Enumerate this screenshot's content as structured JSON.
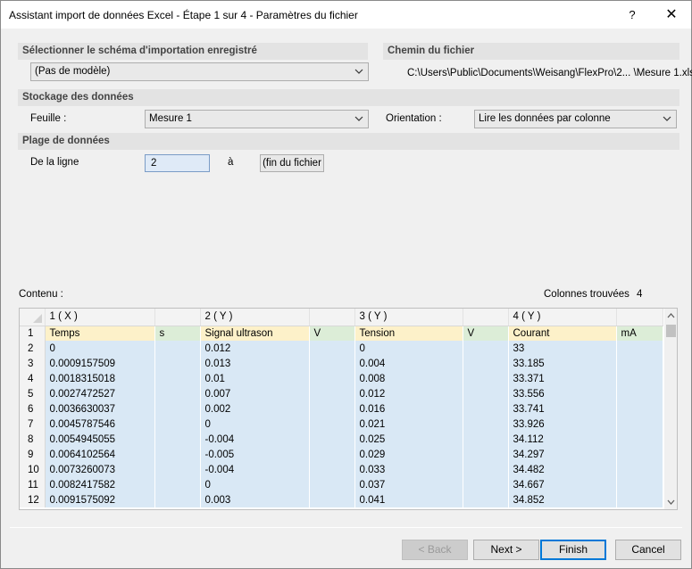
{
  "window": {
    "title": "Assistant import de données Excel - Étape 1 sur 4 - Paramètres du fichier",
    "help_glyph": "?",
    "close_glyph": "✕"
  },
  "schema": {
    "heading": "Sélectionner le schéma d'importation enregistré",
    "selected": "(Pas de modèle)"
  },
  "filepath": {
    "heading": "Chemin du fichier",
    "value": "C:\\Users\\Public\\Documents\\Weisang\\FlexPro\\2... \\Mesure 1.xls"
  },
  "storage": {
    "heading": "Stockage des données",
    "sheet_label": "Feuille :",
    "sheet_value": "Mesure 1",
    "orientation_label": "Orientation :",
    "orientation_value": "Lire les données par colonne"
  },
  "range": {
    "heading": "Plage de données",
    "from_label": "De la ligne",
    "from_value": "2",
    "to_label": "à",
    "to_value": "(fin du fichier"
  },
  "content": {
    "label": "Contenu :",
    "columns_found_label": "Colonnes trouvées",
    "columns_found_value": "4"
  },
  "grid": {
    "column_headers": [
      "1 ( X )",
      "2 ( Y )",
      "3 ( Y )",
      "4 ( Y )"
    ],
    "names": [
      "Temps",
      "Signal ultrason",
      "Tension",
      "Courant"
    ],
    "units": [
      "s",
      "V",
      "V",
      "mA"
    ],
    "row_numbers": [
      "1",
      "2",
      "3",
      "4",
      "5",
      "6",
      "7",
      "8",
      "9",
      "10",
      "11",
      "12"
    ],
    "rows": [
      [
        "0",
        "0.012",
        "0",
        "33"
      ],
      [
        "0.0009157509",
        "0.013",
        "0.004",
        "33.185"
      ],
      [
        "0.0018315018",
        "0.01",
        "0.008",
        "33.371"
      ],
      [
        "0.0027472527",
        "0.007",
        "0.012",
        "33.556"
      ],
      [
        "0.0036630037",
        "0.002",
        "0.016",
        "33.741"
      ],
      [
        "0.0045787546",
        "0",
        "0.021",
        "33.926"
      ],
      [
        "0.0054945055",
        "-0.004",
        "0.025",
        "34.112"
      ],
      [
        "0.0064102564",
        "-0.005",
        "0.029",
        "34.297"
      ],
      [
        "0.0073260073",
        "-0.004",
        "0.033",
        "34.482"
      ],
      [
        "0.0082417582",
        "0",
        "0.037",
        "34.667"
      ],
      [
        "0.0091575092",
        "0.003",
        "0.041",
        "34.852"
      ]
    ]
  },
  "buttons": {
    "back": "< Back",
    "next": "Next >",
    "finish": "Finish",
    "cancel": "Cancel"
  }
}
